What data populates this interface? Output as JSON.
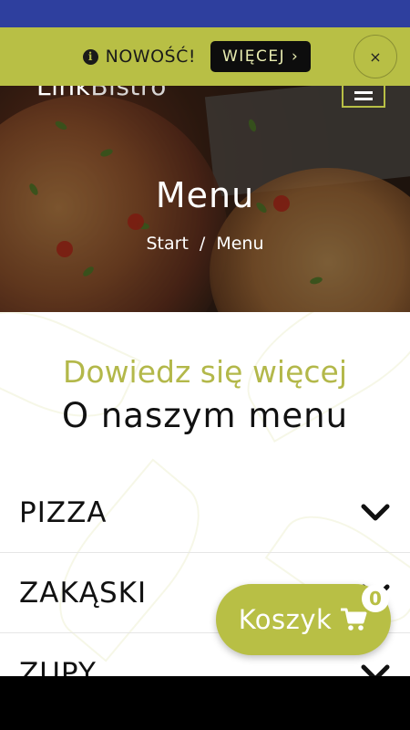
{
  "notice": {
    "icon": "info-icon",
    "text": "NOWOŚĆ!",
    "button_label": "WIĘCEJ ›",
    "close_label": "×"
  },
  "header": {
    "logo_bold": "Link",
    "logo_light": "Bistro",
    "menu_icon": "hamburger-icon"
  },
  "hero": {
    "title": "Menu",
    "breadcrumb": [
      "Start",
      "Menu"
    ],
    "breadcrumb_sep": "/"
  },
  "section": {
    "subtitle": "Dowiedz się więcej",
    "heading": "O naszym menu"
  },
  "categories": [
    {
      "label": "PIZZA"
    },
    {
      "label": "ZAKĄSKI"
    },
    {
      "label": "ZUPY"
    }
  ],
  "cart": {
    "label": "Koszyk",
    "count": "0",
    "icon": "cart-icon"
  },
  "colors": {
    "accent": "#b8bf45",
    "status_bar": "#2e3f9e"
  }
}
